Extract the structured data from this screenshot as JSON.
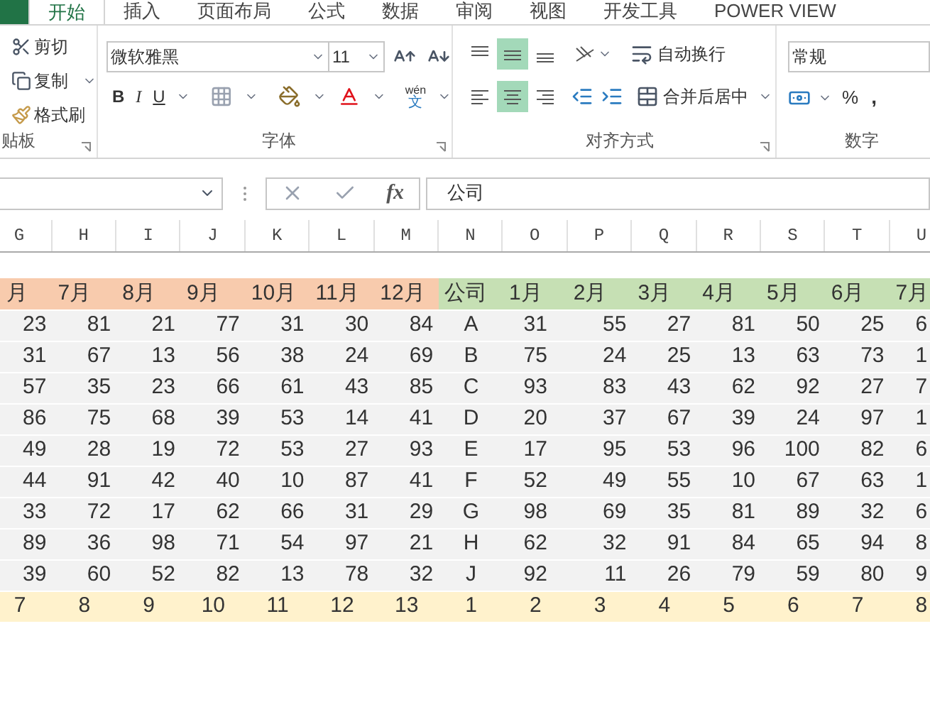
{
  "ribbon": {
    "tabs": [
      {
        "label": "开始",
        "selected": true
      },
      {
        "label": "插入",
        "selected": false
      },
      {
        "label": "页面布局",
        "selected": false
      },
      {
        "label": "公式",
        "selected": false
      },
      {
        "label": "数据",
        "selected": false
      },
      {
        "label": "审阅",
        "selected": false
      },
      {
        "label": "视图",
        "selected": false
      },
      {
        "label": "开发工具",
        "selected": false
      },
      {
        "label": "POWER VIEW",
        "selected": false
      }
    ],
    "clipboard": {
      "cut": "剪切",
      "copy": "复制",
      "format_painter": "格式刷",
      "label": "贴板"
    },
    "font": {
      "name": "微软雅黑",
      "size": "11",
      "styles": [
        "B",
        "I",
        "U"
      ],
      "phonetic_top": "wén",
      "phonetic_bottom": "文",
      "label": "字体"
    },
    "alignment": {
      "vertical": [
        {
          "selected": false
        },
        {
          "selected": true
        },
        {
          "selected": false
        }
      ],
      "horizontal": [
        {
          "selected": false
        },
        {
          "selected": true
        },
        {
          "selected": false
        }
      ],
      "wrap": "自动换行",
      "merge": "合并后居中",
      "label": "对齐方式"
    },
    "number": {
      "format": "常规",
      "percent": "%",
      "comma": ",",
      "label": "数字"
    }
  },
  "formula_bar": {
    "fx": "fx",
    "value": "公司"
  },
  "sheet": {
    "column_letters": [
      "G",
      "H",
      "I",
      "J",
      "K",
      "L",
      "M",
      "N",
      "O",
      "P",
      "Q",
      "R",
      "S",
      "T",
      "U"
    ],
    "header_row": [
      {
        "text": "月",
        "color": "#f8cbad"
      },
      {
        "text": "7月",
        "color": "#f8cbad"
      },
      {
        "text": "8月",
        "color": "#f8cbad"
      },
      {
        "text": "9月",
        "color": "#f8cbad"
      },
      {
        "text": "10月",
        "color": "#f8cbad"
      },
      {
        "text": "11月",
        "color": "#f8cbad"
      },
      {
        "text": "12月",
        "color": "#f8cbad"
      },
      {
        "text": "公司",
        "color": "#c6e0b4"
      },
      {
        "text": "1月",
        "color": "#c6e0b4"
      },
      {
        "text": "2月",
        "color": "#c6e0b4"
      },
      {
        "text": "3月",
        "color": "#c6e0b4"
      },
      {
        "text": "4月",
        "color": "#c6e0b4"
      },
      {
        "text": "5月",
        "color": "#c6e0b4"
      },
      {
        "text": "6月",
        "color": "#c6e0b4"
      },
      {
        "text": "7月",
        "color": "#c6e0b4"
      }
    ],
    "rows": [
      [
        "23",
        "81",
        "21",
        "77",
        "31",
        "30",
        "84",
        "A",
        "31",
        "55",
        "27",
        "81",
        "50",
        "25",
        "6"
      ],
      [
        "31",
        "67",
        "13",
        "56",
        "38",
        "24",
        "69",
        "B",
        "75",
        "24",
        "25",
        "13",
        "63",
        "73",
        "1"
      ],
      [
        "57",
        "35",
        "23",
        "66",
        "61",
        "43",
        "85",
        "C",
        "93",
        "83",
        "43",
        "62",
        "92",
        "27",
        "7"
      ],
      [
        "86",
        "75",
        "68",
        "39",
        "53",
        "14",
        "41",
        "D",
        "20",
        "37",
        "67",
        "39",
        "24",
        "97",
        "1"
      ],
      [
        "49",
        "28",
        "19",
        "72",
        "53",
        "27",
        "93",
        "E",
        "17",
        "95",
        "53",
        "96",
        "100",
        "82",
        "6"
      ],
      [
        "44",
        "91",
        "42",
        "40",
        "10",
        "87",
        "41",
        "F",
        "52",
        "49",
        "55",
        "10",
        "67",
        "63",
        "1"
      ],
      [
        "33",
        "72",
        "17",
        "62",
        "66",
        "31",
        "29",
        "G",
        "98",
        "69",
        "35",
        "81",
        "89",
        "32",
        "6"
      ],
      [
        "89",
        "36",
        "98",
        "71",
        "54",
        "97",
        "21",
        "H",
        "62",
        "32",
        "91",
        "84",
        "65",
        "94",
        "8"
      ],
      [
        "39",
        "60",
        "52",
        "82",
        "13",
        "78",
        "32",
        "J",
        "92",
        "11",
        "26",
        "79",
        "59",
        "80",
        "9"
      ]
    ],
    "total_row": [
      "7",
      "8",
      "9",
      "10",
      "11",
      "12",
      "13",
      "1",
      "2",
      "3",
      "4",
      "5",
      "6",
      "7",
      "8"
    ]
  }
}
